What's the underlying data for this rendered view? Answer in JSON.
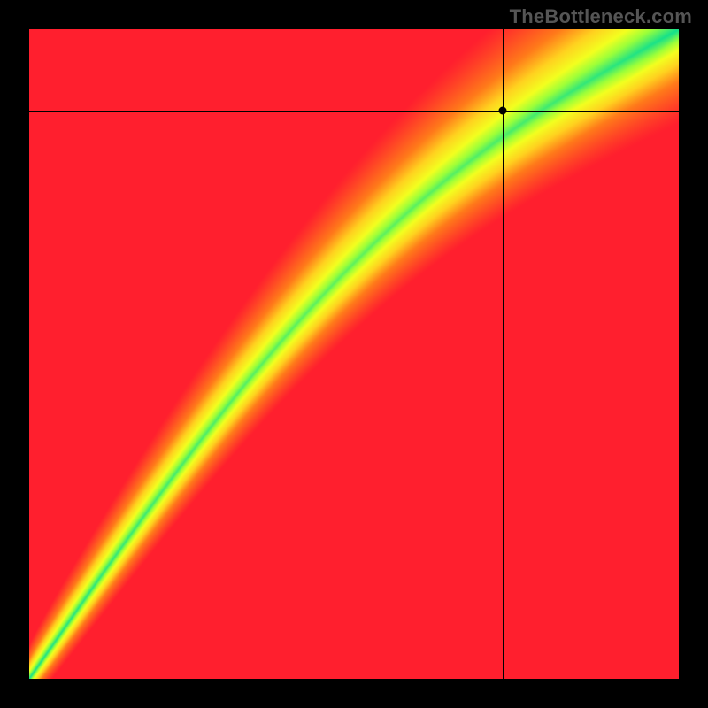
{
  "watermark": "TheBottleneck.com",
  "chart_data": {
    "type": "heatmap",
    "title": "",
    "xlabel": "",
    "ylabel": "",
    "xlim": [
      0,
      1
    ],
    "ylim": [
      0,
      1
    ],
    "crosshair": {
      "x": 0.73,
      "y": 0.875
    },
    "ideal_curve_description": "Diagonal ridge of best pairing (green) from bottom-left to top-right with slight upward S-curve; red = heavy bottleneck; yellow = mild; green = balanced.",
    "colormap": [
      {
        "stop": 0.0,
        "color": "#ff1f2e"
      },
      {
        "stop": 0.35,
        "color": "#ff7a1a"
      },
      {
        "stop": 0.55,
        "color": "#ffd21f"
      },
      {
        "stop": 0.72,
        "color": "#f3ff1f"
      },
      {
        "stop": 0.85,
        "color": "#9bff3a"
      },
      {
        "stop": 1.0,
        "color": "#11e08e"
      }
    ]
  }
}
